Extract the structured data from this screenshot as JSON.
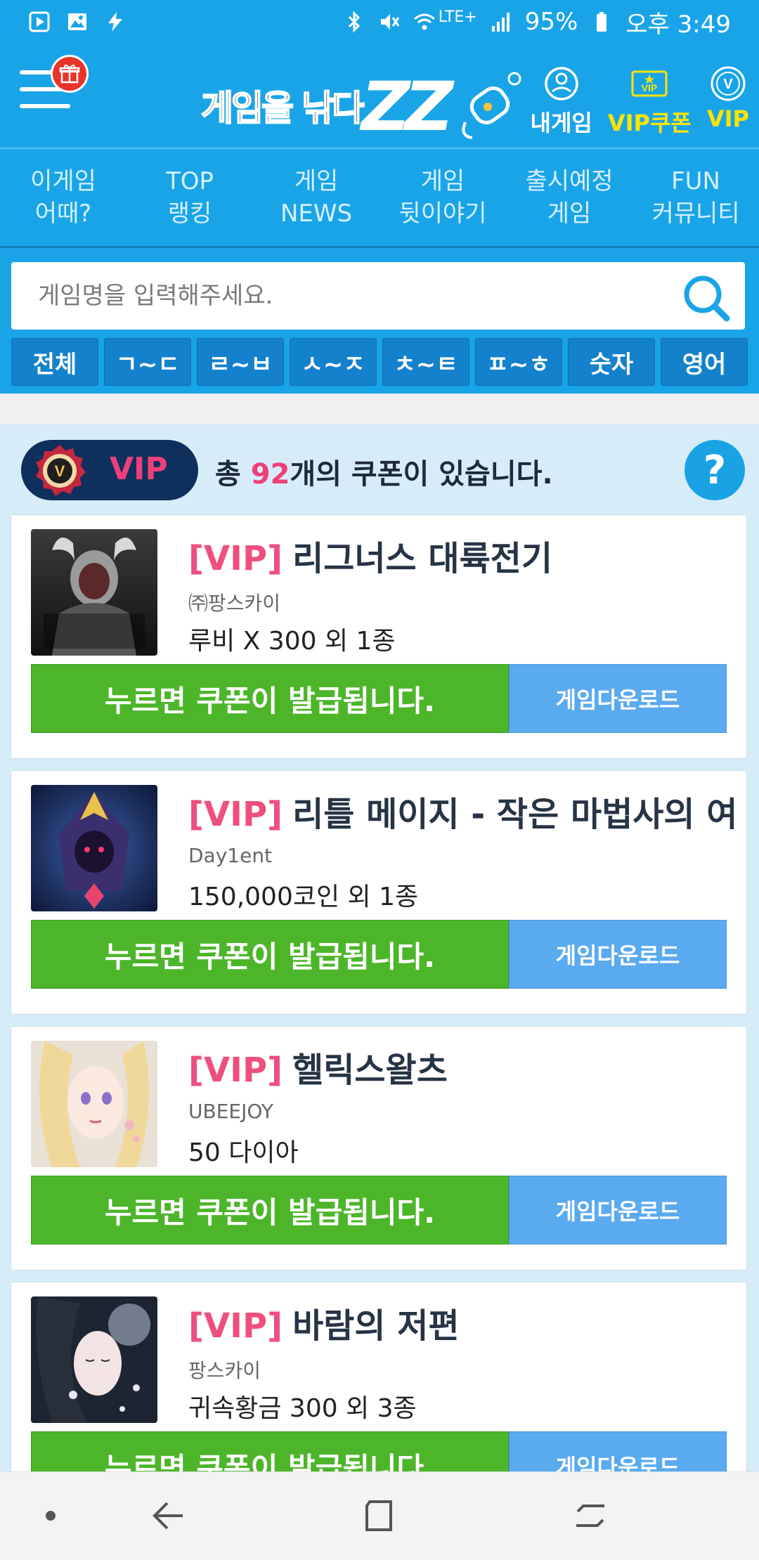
{
  "status_bar": {
    "battery": "95%",
    "time": "오후 3:49",
    "network": "LTE+"
  },
  "header": {
    "logo_text": "게임을 낚다",
    "logo_zz": "ZZ",
    "links": [
      {
        "label": "내게임",
        "icon": "gamepad-icon",
        "color": "#ffffff"
      },
      {
        "label": "VIP쿠폰",
        "icon": "vip-ticket-icon",
        "color": "#ffe400"
      },
      {
        "label": "VIP",
        "icon": "vip-badge-icon",
        "color": "#ffe400"
      }
    ]
  },
  "nav": [
    {
      "label": "이게임\n어때?"
    },
    {
      "label": "TOP\n랭킹"
    },
    {
      "label": "게임\nNEWS"
    },
    {
      "label": "게임\n뒷이야기"
    },
    {
      "label": "출시예정\n게임"
    },
    {
      "label": "FUN\n커뮤니티"
    }
  ],
  "search": {
    "placeholder": "게임명을 입력해주세요."
  },
  "filters": [
    "전체",
    "ㄱ~ㄷ",
    "ㄹ~ㅂ",
    "ㅅ~ㅈ",
    "ㅊ~ㅌ",
    "ㅍ~ㅎ",
    "숫자",
    "영어"
  ],
  "summary": {
    "badge_label": "VIP",
    "prefix": "총 ",
    "count": "92",
    "suffix": "개의 쿠폰이 있습니다.",
    "help": "?"
  },
  "coupons": [
    {
      "tag": "[VIP]",
      "title": "리그너스 대륙전기",
      "publisher": "㈜팡스카이",
      "reward": "루비 X 300 외 1종",
      "issue_label": "누르면 쿠폰이 발급됩니다.",
      "download_label": "게임다운로드"
    },
    {
      "tag": "[VIP]",
      "title": "리틀 메이지 - 작은 마법사의 여정",
      "publisher": "Day1ent",
      "reward": "150,000코인 외 1종",
      "issue_label": "누르면 쿠폰이 발급됩니다.",
      "download_label": "게임다운로드"
    },
    {
      "tag": "[VIP]",
      "title": "헬릭스왈츠",
      "publisher": "UBEEJOY",
      "reward": "50 다이아",
      "issue_label": "누르면 쿠폰이 발급됩니다.",
      "download_label": "게임다운로드"
    },
    {
      "tag": "[VIP]",
      "title": "바람의 저편",
      "publisher": "팡스카이",
      "reward": "귀속황금 300 외 3종",
      "issue_label": "누르면 쿠폰이 발급됩니다.",
      "download_label": "게임다운로드"
    }
  ],
  "colors": {
    "primary": "#1aa4e8",
    "vip_pink": "#ee4f7f",
    "issue_green": "#4db52a",
    "download_blue": "#5aaaf0"
  }
}
